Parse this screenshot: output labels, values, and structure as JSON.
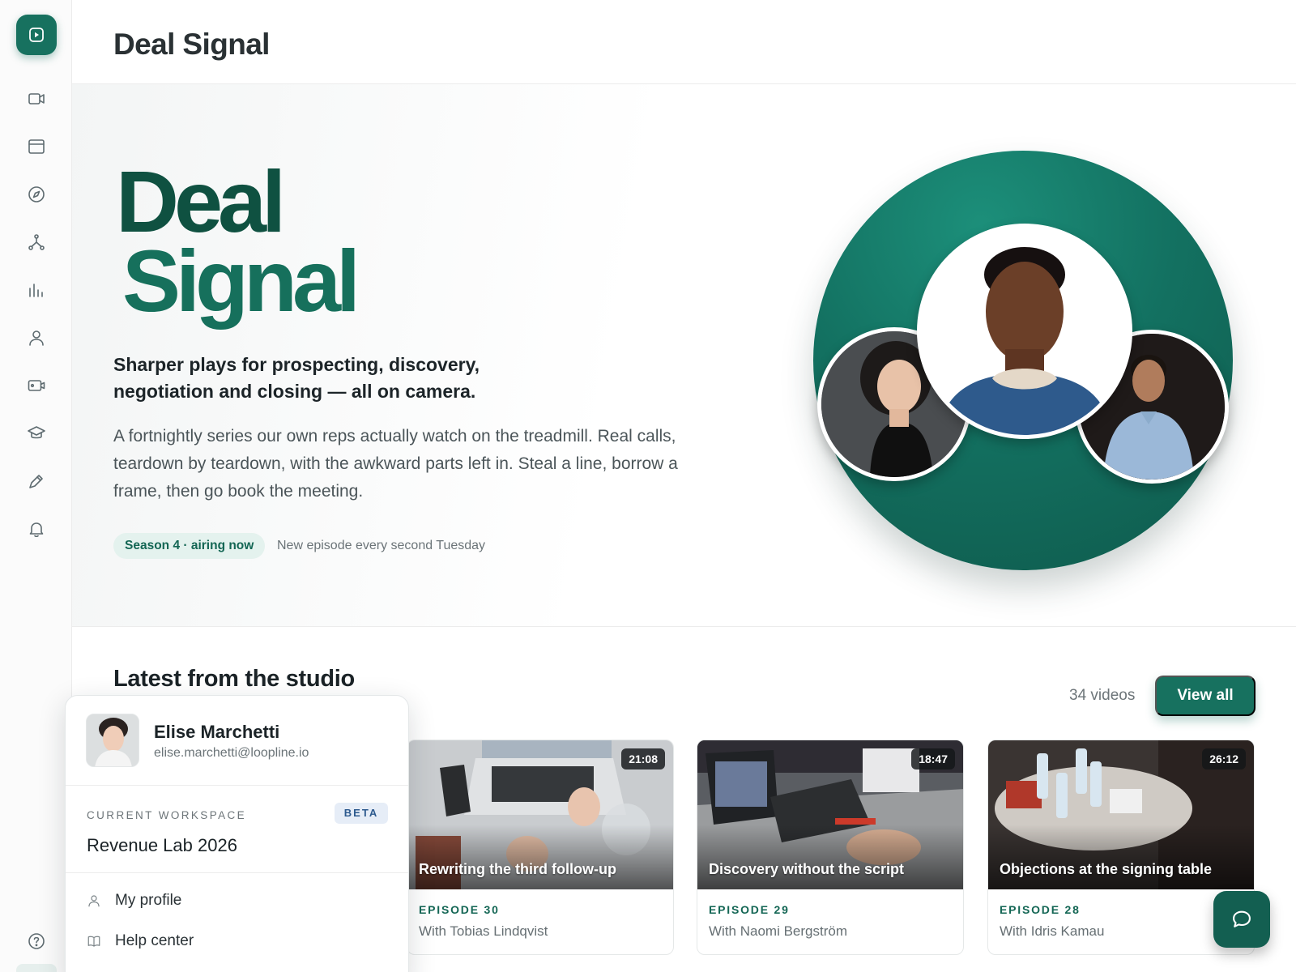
{
  "page": {
    "title": "Deal Signal"
  },
  "sidebar": {
    "items": [
      {
        "icon": "video-icon"
      },
      {
        "icon": "browser-window-icon"
      },
      {
        "icon": "compass-icon"
      },
      {
        "icon": "network-icon"
      },
      {
        "icon": "bar-chart-icon"
      },
      {
        "icon": "user-icon"
      },
      {
        "icon": "camera-icon"
      },
      {
        "icon": "graduation-cap-icon"
      },
      {
        "icon": "pen-icon"
      },
      {
        "icon": "bell-icon"
      }
    ],
    "help_icon": "help-circle-icon"
  },
  "hero": {
    "title_line1": "Deal",
    "title_line2": "Signal",
    "subtitle": "Sharper plays for prospecting, discovery, negotiation and closing — all on camera.",
    "description": "A fortnightly series our own reps actually watch on the treadmill. Real calls, teardown by teardown, with the awkward parts left in. Steal a line, borrow a frame, then go book the meeting.",
    "season_badge": "Season 4 · airing now",
    "schedule_note": "New episode every second Tuesday",
    "accent_color": "#17715f"
  },
  "latest": {
    "title": "Latest from the studio",
    "count": "34 videos",
    "view_all_label": "View all",
    "cards": [
      {
        "duration": "21:08",
        "title": "Rewriting the third follow-up",
        "episode": "EPISODE 30",
        "host": "With Tobias Lindqvist"
      },
      {
        "duration": "18:47",
        "title": "Discovery without the script",
        "episode": "EPISODE 29",
        "host": "With Naomi Bergström"
      },
      {
        "duration": "26:12",
        "title": "Objections at the signing table",
        "episode": "EPISODE 28",
        "host": "With Idris Kamau"
      }
    ]
  },
  "profile_menu": {
    "name": "Elise Marchetti",
    "email": "elise.marchetti@loopline.io",
    "workspace_label": "CURRENT WORKSPACE",
    "beta_label": "BETA",
    "workspace_name": "Revenue Lab 2026",
    "items": [
      {
        "label": "My profile",
        "icon": "user-icon"
      },
      {
        "label": "Help center",
        "icon": "book-icon"
      }
    ]
  }
}
